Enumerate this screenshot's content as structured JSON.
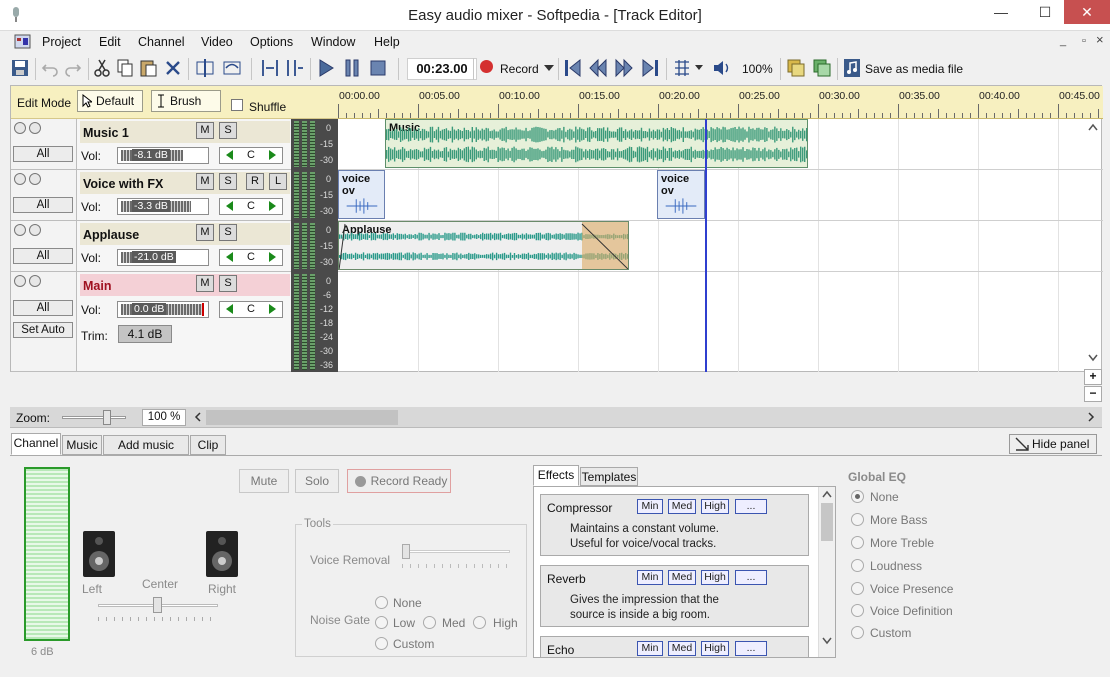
{
  "window": {
    "title": "Easy audio mixer - Softpedia - [Track Editor]",
    "minimize": "—",
    "maximize": "☐",
    "close": "✕"
  },
  "menu": {
    "items": [
      "Project",
      "Edit",
      "Channel",
      "Video",
      "Options",
      "Window",
      "Help"
    ],
    "mdi_min": "_",
    "mdi_max": "▫",
    "mdi_close": "×"
  },
  "toolbar": {
    "time": "00:23.00",
    "record_label": "Record",
    "volume_pct": "100%",
    "save_media": "Save as media file"
  },
  "editor": {
    "mode_label": "Edit Mode",
    "default_btn": "Default",
    "brush_btn": "Brush",
    "shuffle_label": "Shuffle",
    "ruler": [
      "00:00.00",
      "00:05.00",
      "00:10.00",
      "00:15.00",
      "00:20.00",
      "00:25.00",
      "00:30.00",
      "00:35.00",
      "00:40.00",
      "00:45.00"
    ]
  },
  "tracks": [
    {
      "name": "Music 1",
      "vol_label": "Vol:",
      "vol": "-8.1 dB",
      "pan": "C",
      "all": "All",
      "meter": [
        "0",
        "-15",
        "-30"
      ],
      "m": "M",
      "s": "S"
    },
    {
      "name": "Voice with FX",
      "vol_label": "Vol:",
      "vol": "-3.3 dB",
      "pan": "C",
      "all": "All",
      "meter": [
        "0",
        "-15",
        "-30"
      ],
      "m": "M",
      "s": "S",
      "r": "R",
      "l": "L"
    },
    {
      "name": "Applause",
      "vol_label": "Vol:",
      "vol": "-21.0 dB",
      "pan": "C",
      "all": "All",
      "meter": [
        "0",
        "-15",
        "-30"
      ],
      "m": "M",
      "s": "S"
    },
    {
      "name": "Main",
      "vol_label": "Vol:",
      "vol": "0.0 dB",
      "pan": "C",
      "all": "All",
      "set_auto": "Set Auto",
      "trim_label": "Trim:",
      "trim": "4.1 dB",
      "meter": [
        "0",
        "-6",
        "-12",
        "-18",
        "-24",
        "-30",
        "-36"
      ],
      "m": "M",
      "s": "S"
    }
  ],
  "clips": {
    "music": "Music",
    "voice1": "voice ov",
    "voice2": "voice ov",
    "applause": "Applause"
  },
  "zoom": {
    "label": "Zoom:",
    "value": "100 %"
  },
  "panel": {
    "tabs": [
      "Channel",
      "Music",
      "Add music file...",
      "Clip"
    ],
    "hide": "Hide panel",
    "fader_db": "6 dB",
    "left": "Left",
    "center": "Center",
    "right": "Right",
    "mute": "Mute",
    "solo": "Solo",
    "record_ready": "Record Ready",
    "tools_title": "Tools",
    "voice_removal": "Voice Removal",
    "noise_gate": "Noise Gate",
    "gate_opts": [
      "None",
      "Low",
      "Med",
      "High",
      "Custom"
    ],
    "effects_tabs": [
      "Effects",
      "Templates"
    ],
    "effects": [
      {
        "name": "Compressor",
        "min": "Min",
        "med": "Med",
        "high": "High",
        "more": "...",
        "desc1": "Maintains a constant volume.",
        "desc2": "Useful for voice/vocal tracks."
      },
      {
        "name": "Reverb",
        "min": "Min",
        "med": "Med",
        "high": "High",
        "more": "...",
        "desc1": "Gives the impression that the",
        "desc2": "source is inside a big room."
      },
      {
        "name": "Echo",
        "min": "Min",
        "med": "Med",
        "high": "High",
        "more": "..."
      }
    ],
    "eq_title": "Global EQ",
    "eq_opts": [
      "None",
      "More Bass",
      "More Treble",
      "Loudness",
      "Voice Presence",
      "Voice Definition",
      "Custom"
    ]
  }
}
